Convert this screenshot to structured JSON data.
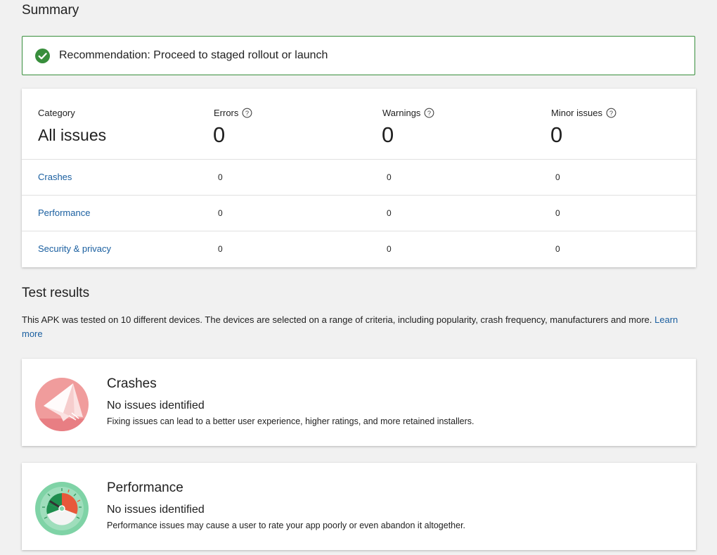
{
  "summary": {
    "heading": "Summary",
    "recommendation": "Recommendation: Proceed to staged rollout or launch",
    "category_label": "Category",
    "category_value": "All issues",
    "columns": [
      {
        "label": "Errors",
        "total": "0"
      },
      {
        "label": "Warnings",
        "total": "0"
      },
      {
        "label": "Minor issues",
        "total": "0"
      }
    ],
    "rows": [
      {
        "category": "Crashes",
        "errors": "0",
        "warnings": "0",
        "minor": "0"
      },
      {
        "category": "Performance",
        "errors": "0",
        "warnings": "0",
        "minor": "0"
      },
      {
        "category": "Security & privacy",
        "errors": "0",
        "warnings": "0",
        "minor": "0"
      }
    ]
  },
  "test_results": {
    "heading": "Test results",
    "description": "This APK was tested on 10 different devices. The devices are selected on a range of criteria, including popularity, crash frequency, manufacturers and more.",
    "learn_more": "Learn more",
    "cards": [
      {
        "title": "Crashes",
        "status": "No issues identified",
        "note": "Fixing issues can lead to a better user experience, higher ratings, and more retained installers.",
        "icon": "crash-illustration-icon"
      },
      {
        "title": "Performance",
        "status": "No issues identified",
        "note": "Performance issues may cause a user to rate your app poorly or even abandon it altogether.",
        "icon": "performance-gauge-icon"
      }
    ]
  },
  "colors": {
    "success": "#388e3c",
    "link": "#1a5fa0",
    "crash_bg": "#f09c9c",
    "perf_bg": "#7fd3a6"
  }
}
